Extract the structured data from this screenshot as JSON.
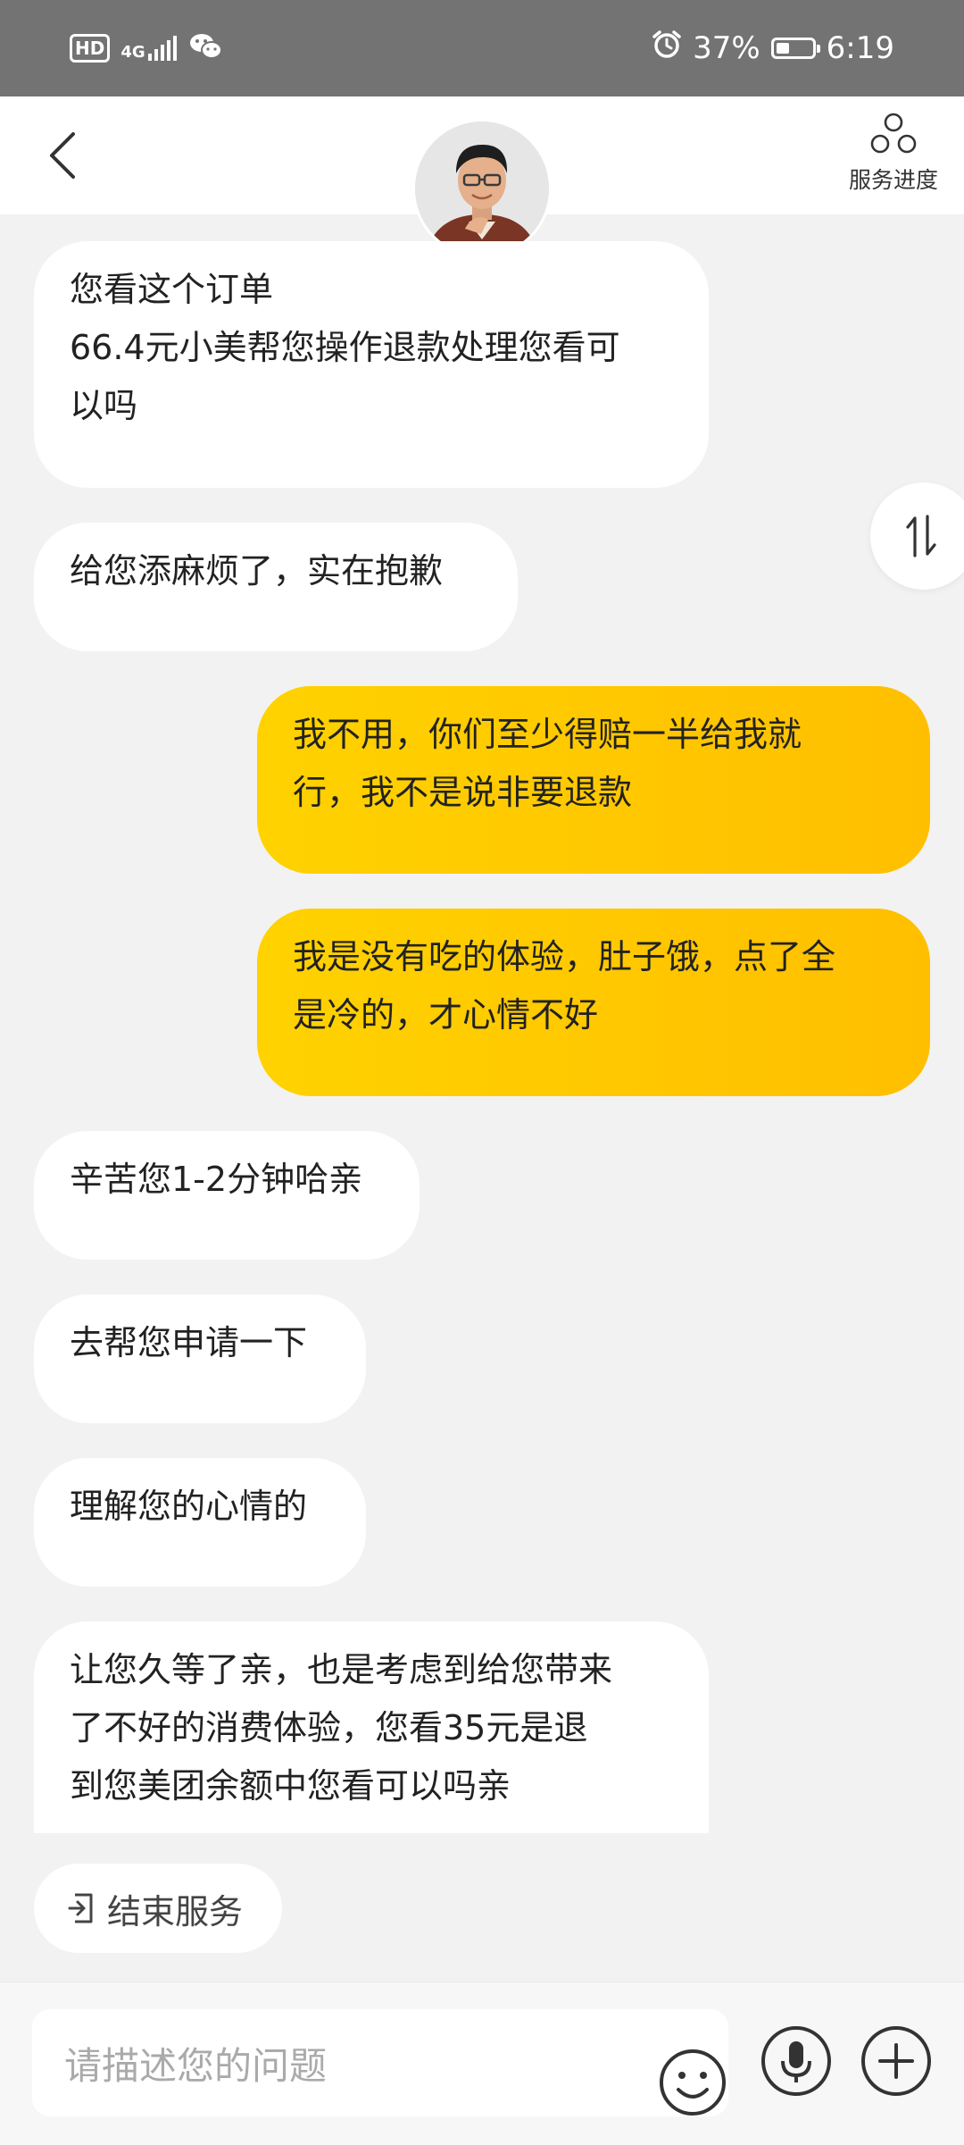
{
  "status_bar": {
    "hd": "HD",
    "network": "4G",
    "battery_percent": "37%",
    "battery_level": 0.37,
    "time": "6:19",
    "icons": [
      "hd-icon",
      "signal-icon",
      "wechat-icon",
      "alarm-icon",
      "battery-icon"
    ]
  },
  "header": {
    "progress_label": "服务进度"
  },
  "messages": [
    {
      "side": "left",
      "text": "您看这个订单\n66.4元小美帮您操作退款处理您看可\n以吗"
    },
    {
      "side": "left",
      "text": "给您添麻烦了，实在抱歉"
    },
    {
      "side": "right",
      "text": "我不用，你们至少得赔一半给我就\n行，我不是说非要退款"
    },
    {
      "side": "right",
      "text": "我是没有吃的体验，肚子饿，点了全\n是冷的，才心情不好"
    },
    {
      "side": "left",
      "text": "辛苦您1-2分钟哈亲"
    },
    {
      "side": "left",
      "text": "去帮您申请一下"
    },
    {
      "side": "left",
      "text": "理解您的心情的"
    },
    {
      "side": "left",
      "text": "让您久等了亲，也是考虑到给您带来\n了不好的消费体验，您看35元是退\n到您美团余额中您看可以吗亲"
    }
  ],
  "end_service_label": "结束服务",
  "input": {
    "placeholder": "请描述您的问题"
  },
  "colors": {
    "user_bubble": "#ffc600",
    "agent_bubble": "#ffffff",
    "background": "#f2f2f2"
  }
}
